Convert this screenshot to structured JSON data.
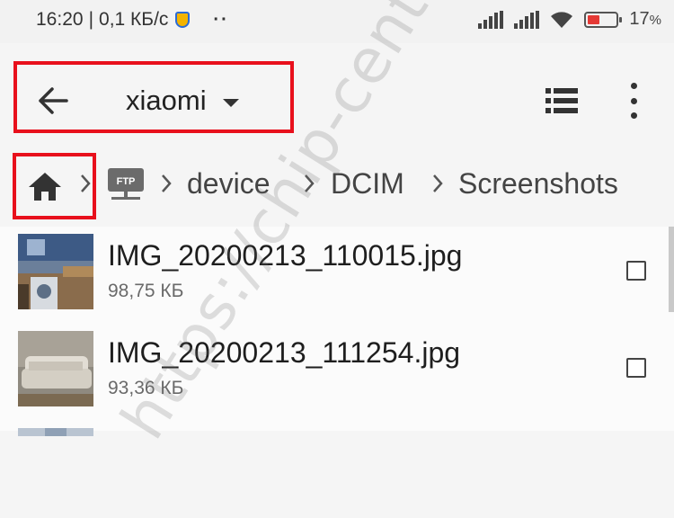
{
  "status_bar": {
    "time": "16:20",
    "speed": "0,1 КБ/с",
    "battery_percent": "17",
    "battery_unit": "%",
    "battery_level": 0.17,
    "icons": [
      "shield-icon",
      "more-dots-icon",
      "signal-icon",
      "signal-icon",
      "wifi-icon",
      "battery-icon"
    ]
  },
  "toolbar": {
    "server_name": "xiaomi",
    "icons": [
      "back-arrow-icon",
      "dropdown-caret-icon",
      "list-view-icon",
      "more-vert-icon"
    ]
  },
  "breadcrumb": {
    "items": [
      "device",
      "DCIM",
      "Screenshots"
    ],
    "icons": [
      "home-icon",
      "ftp-server-icon",
      "chevron-right-icon"
    ]
  },
  "files": [
    {
      "name": "IMG_20200213_110015.jpg",
      "size": "98,75 КБ",
      "checked": false
    },
    {
      "name": "IMG_20200213_111254.jpg",
      "size": "93,36 КБ",
      "checked": false
    }
  ],
  "watermark": "https://chip-center.ru",
  "colors": {
    "highlight": "#e8101c",
    "battery_low": "#e53935",
    "background": "#f5f5f5"
  }
}
